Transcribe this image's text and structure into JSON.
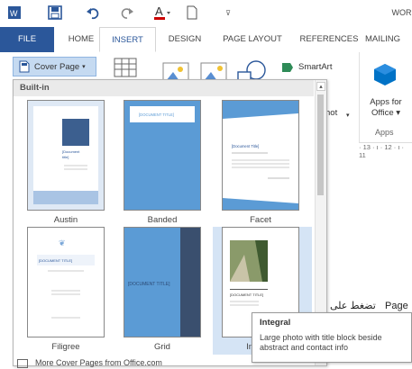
{
  "title_partial": "WOR",
  "tabs": [
    "FILE",
    "HOME",
    "INSERT",
    "DESIGN",
    "PAGE LAYOUT",
    "REFERENCES",
    "MAILING"
  ],
  "cover_page_label": "Cover Page",
  "smartart_label": "SmartArt",
  "screenshot_partial": "hot",
  "apps_for_office_line1": "Apps for",
  "apps_for_office_line2": "Office",
  "apps_group": "Apps",
  "ruler": "· 13 · ı · 12 · ı · 11",
  "gallery_header": "Built-in",
  "items": [
    "Austin",
    "Banded",
    "Facet",
    "Filigree",
    "Grid",
    "Integral"
  ],
  "thumb_text": {
    "doc_title": "[DOCUMENT TITLE]",
    "doc_title_mixed": "[Document Title]"
  },
  "tooltip": {
    "title": "Integral",
    "desc": "Large photo with title block beside abstract and contact info"
  },
  "doc_text_arabic": "تضغط على",
  "doc_text_page": "Page",
  "more_label": "More Cover Pages from Office.com",
  "colors": {
    "accent": "#2b579a",
    "sel": "#d5e4f5"
  }
}
